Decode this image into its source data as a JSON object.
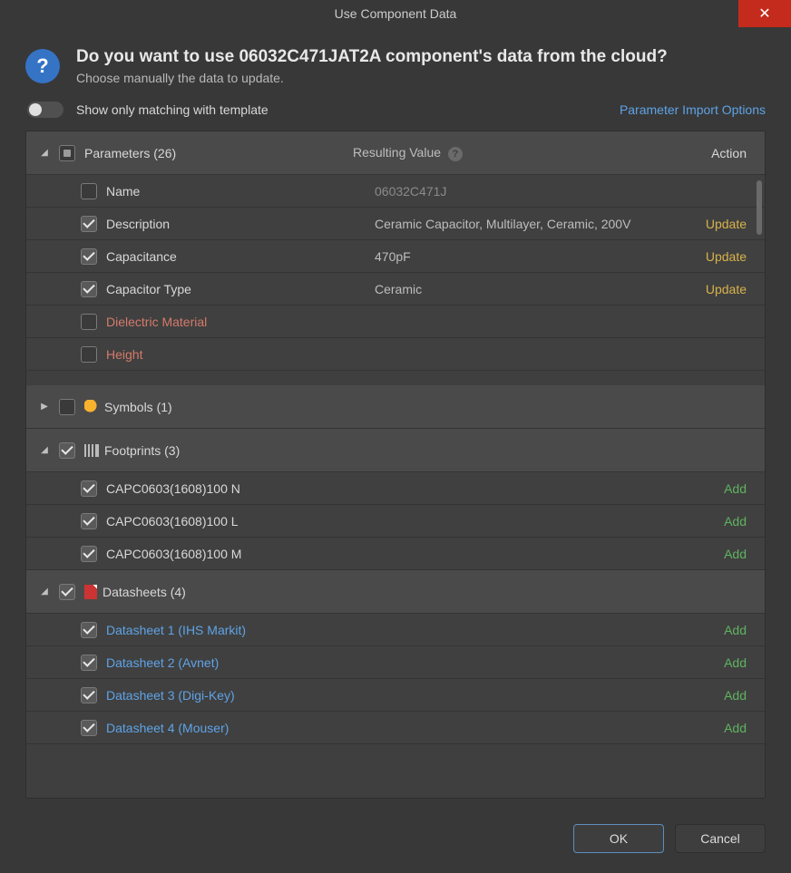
{
  "title": "Use Component Data",
  "heading": "Do you want to use 06032C471JAT2A component's data from the cloud?",
  "subheading": "Choose manually the data to update.",
  "toggle_label": "Show only matching with template",
  "import_options": "Parameter Import Options",
  "columns": {
    "value": "Resulting Value",
    "action": "Action"
  },
  "sections": {
    "parameters": {
      "label": "Parameters (26)",
      "expanded": true,
      "items": [
        {
          "checked": false,
          "name": "Name",
          "value": "06032C471J",
          "action": "",
          "warn": false,
          "dim": true
        },
        {
          "checked": true,
          "name": "Description",
          "value": "Ceramic Capacitor, Multilayer, Ceramic, 200V",
          "action": "Update",
          "warn": false,
          "dim": false
        },
        {
          "checked": true,
          "name": "Capacitance",
          "value": "470pF",
          "action": "Update",
          "warn": false,
          "dim": false
        },
        {
          "checked": true,
          "name": "Capacitor Type",
          "value": "Ceramic",
          "action": "Update",
          "warn": false,
          "dim": false
        },
        {
          "checked": false,
          "name": "Dielectric Material",
          "value": "",
          "action": "",
          "warn": true,
          "dim": false
        },
        {
          "checked": false,
          "name": "Height",
          "value": "",
          "action": "",
          "warn": true,
          "dim": false
        }
      ]
    },
    "symbols": {
      "label": "Symbols (1)",
      "expanded": false
    },
    "footprints": {
      "label": "Footprints (3)",
      "expanded": true,
      "items": [
        {
          "checked": true,
          "name": "CAPC0603(1608)100 N",
          "action": "Add"
        },
        {
          "checked": true,
          "name": "CAPC0603(1608)100 L",
          "action": "Add"
        },
        {
          "checked": true,
          "name": "CAPC0603(1608)100 M",
          "action": "Add"
        }
      ]
    },
    "datasheets": {
      "label": "Datasheets (4)",
      "expanded": true,
      "items": [
        {
          "checked": true,
          "name": "Datasheet 1 (IHS Markit)",
          "action": "Add"
        },
        {
          "checked": true,
          "name": "Datasheet 2 (Avnet)",
          "action": "Add"
        },
        {
          "checked": true,
          "name": "Datasheet 3 (Digi-Key)",
          "action": "Add"
        },
        {
          "checked": true,
          "name": "Datasheet 4 (Mouser)",
          "action": "Add"
        }
      ]
    }
  },
  "buttons": {
    "ok": "OK",
    "cancel": "Cancel"
  }
}
